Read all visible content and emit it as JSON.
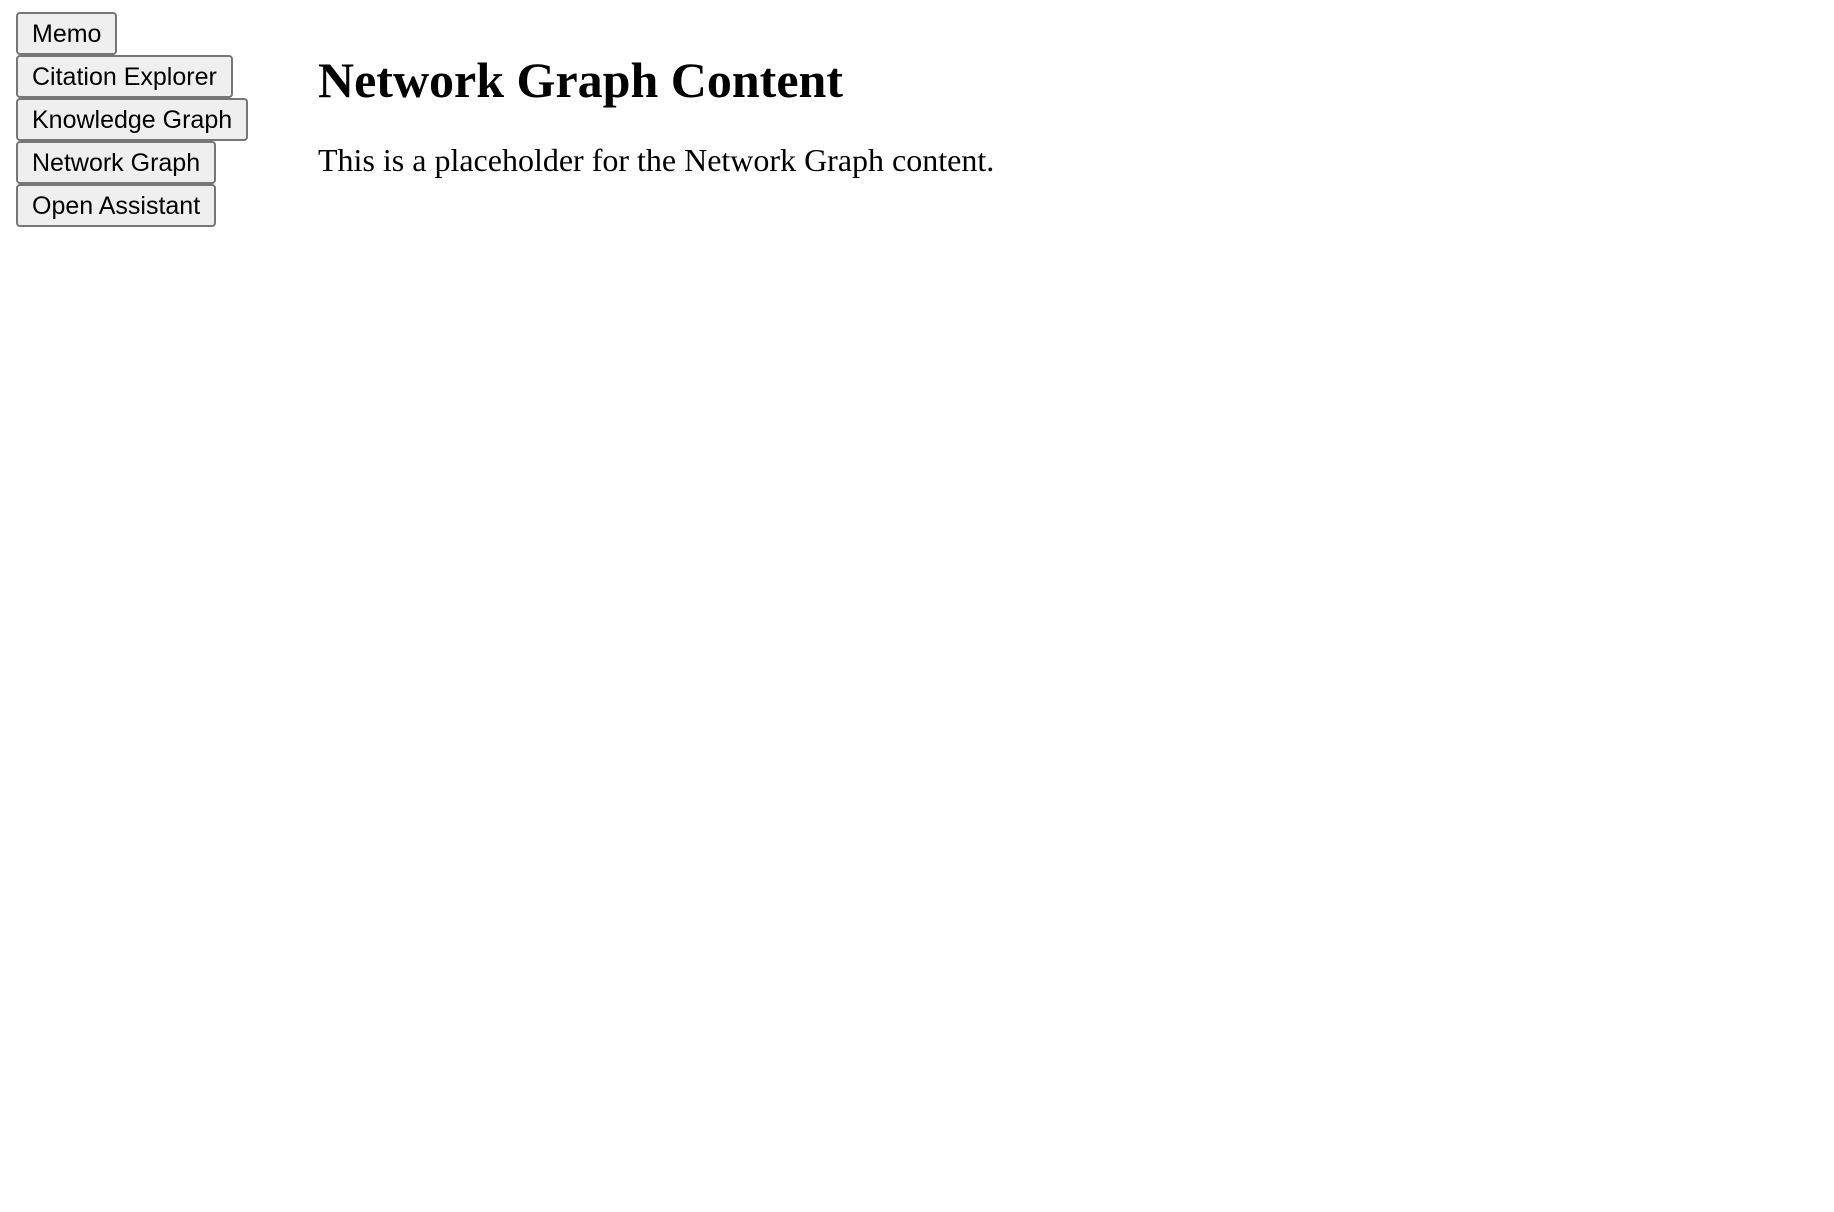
{
  "sidebar": {
    "buttons": [
      {
        "label": "Memo"
      },
      {
        "label": "Citation Explorer"
      },
      {
        "label": "Knowledge Graph"
      },
      {
        "label": "Network Graph"
      },
      {
        "label": "Open Assistant"
      }
    ]
  },
  "main": {
    "title": "Network Graph Content",
    "description": "This is a placeholder for the Network Graph content."
  }
}
